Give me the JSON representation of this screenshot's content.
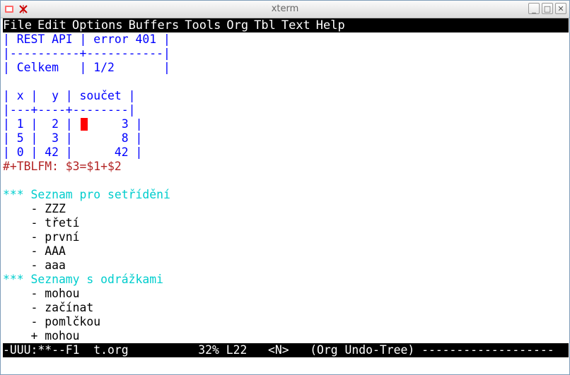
{
  "window": {
    "title": "xterm",
    "minimize": "_",
    "maximize": "□",
    "close": "✕"
  },
  "menu": [
    "File",
    "Edit",
    "Options",
    "Buffers",
    "Tools",
    "Org",
    "Tbl",
    "Text",
    "Help"
  ],
  "table1": {
    "row1": "| REST API | error 401 |",
    "sep": "|----------+-----------|",
    "row2": "| Celkem   | 1/2       |"
  },
  "table2": {
    "header": "| x |  y | součet |",
    "sep": "|---+----+--------|",
    "rows": [
      {
        "left": "| 1 |  2 | ",
        "right": "     3 |"
      },
      {
        "left": "| 5 |  3 |       8 |",
        "right": ""
      },
      {
        "left": "| 0 | 42 |      42 |",
        "right": ""
      }
    ]
  },
  "formula": "#+TBLFM: $3=$1+$2",
  "heading1": "*** Seznam pro setřídění",
  "list1": [
    "    - ZZZ",
    "    - třetí",
    "    - první",
    "    - AAA",
    "    - aaa"
  ],
  "heading2": "*** Seznamy s odrážkami",
  "list2": [
    "    - mohou",
    "    - začínat",
    "    - pomlčkou",
    "    + mohou"
  ],
  "modeline": "-UUU:**--F1  t.org          32% L22   <N>   (Org Undo-Tree) -------------------"
}
